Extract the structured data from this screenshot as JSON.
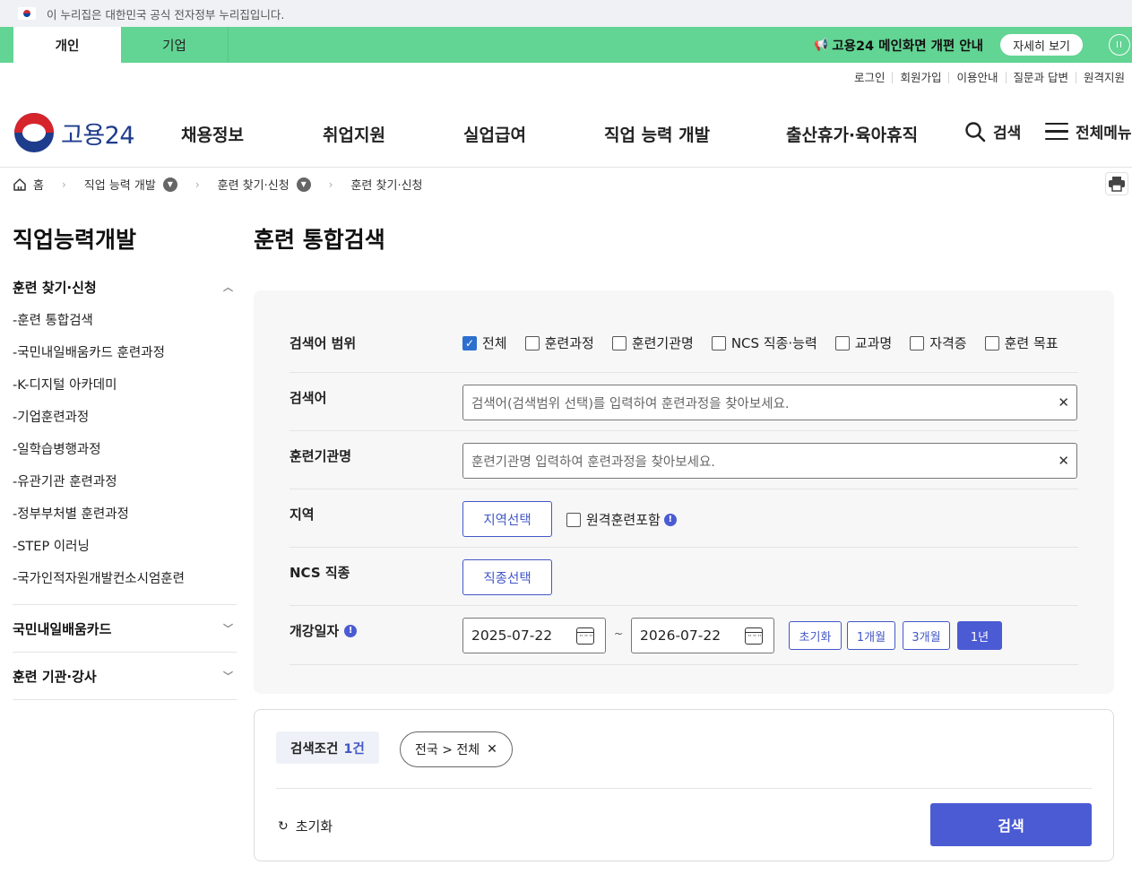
{
  "gov_banner": "이 누리집은 대한민국 공식 전자정부 누리집입니다.",
  "service_tabs": [
    {
      "label": "개인"
    },
    {
      "label": "기업"
    }
  ],
  "notice": {
    "text": "고용24 메인화면 개편 안내",
    "button": "자세히 보기"
  },
  "util_links": [
    "로그인",
    "회원가입",
    "이용안내",
    "질문과 답변",
    "원격지원"
  ],
  "logo": "고용24",
  "gnb": [
    "채용정보",
    "취업지원",
    "실업급여",
    "직업 능력 개발",
    "출산휴가·육아휴직"
  ],
  "gnb_search": "검색",
  "gnb_menu": "전체메뉴",
  "breadcrumb": {
    "home": "홈",
    "level1": "직업 능력 개발",
    "level2": "훈련 찾기·신청",
    "level3": "훈련 찾기·신청"
  },
  "side": {
    "title": "직업능력개발",
    "group1": "훈련 찾기·신청",
    "items": [
      "-훈련 통합검색",
      "-국민내일배움카드 훈련과정",
      "-K-디지털 아카데미",
      "-기업훈련과정",
      "-일학습병행과정",
      "-유관기관 훈련과정",
      "-정부부처별 훈련과정",
      "-STEP 이러닝",
      "-국가인적자원개발컨소시엄훈련"
    ],
    "group2": "국민내일배움카드",
    "group3": "훈련 기관·강사"
  },
  "main_title": "훈련 통합검색",
  "form": {
    "scope_label": "검색어 범위",
    "scope_options": [
      {
        "label": "전체",
        "checked": true
      },
      {
        "label": "훈련과정",
        "checked": false
      },
      {
        "label": "훈련기관명",
        "checked": false
      },
      {
        "label": "NCS 직종·능력",
        "checked": false
      },
      {
        "label": "교과명",
        "checked": false
      },
      {
        "label": "자격증",
        "checked": false
      },
      {
        "label": "훈련 목표",
        "checked": false
      }
    ],
    "keyword_label": "검색어",
    "keyword_placeholder": "검색어(검색범위 선택)를 입력하여 훈련과정을 찾아보세요.",
    "org_label": "훈련기관명",
    "org_placeholder": "훈련기관명 입력하여 훈련과정을 찾아보세요.",
    "region_label": "지역",
    "region_button": "지역선택",
    "remote_label": "원격훈련포함",
    "ncs_label": "NCS 직종",
    "ncs_button": "직종선택",
    "date_label": "개강일자",
    "date_from": "2025-07-22",
    "date_sep": "~",
    "date_to": "2026-07-22",
    "periods": [
      {
        "label": "초기화",
        "active": false
      },
      {
        "label": "1개월",
        "active": false
      },
      {
        "label": "3개월",
        "active": false
      },
      {
        "label": "1년",
        "active": true
      }
    ]
  },
  "conditions": {
    "label": "검색조건",
    "count": "1건",
    "chip": "전국 > 전체",
    "reset": "초기화",
    "search": "검색"
  },
  "colors": {
    "service_bar": "#62d493",
    "primary": "#4b5bd3",
    "outline": "#4257c7",
    "checkbox": "#2d6fcf"
  }
}
